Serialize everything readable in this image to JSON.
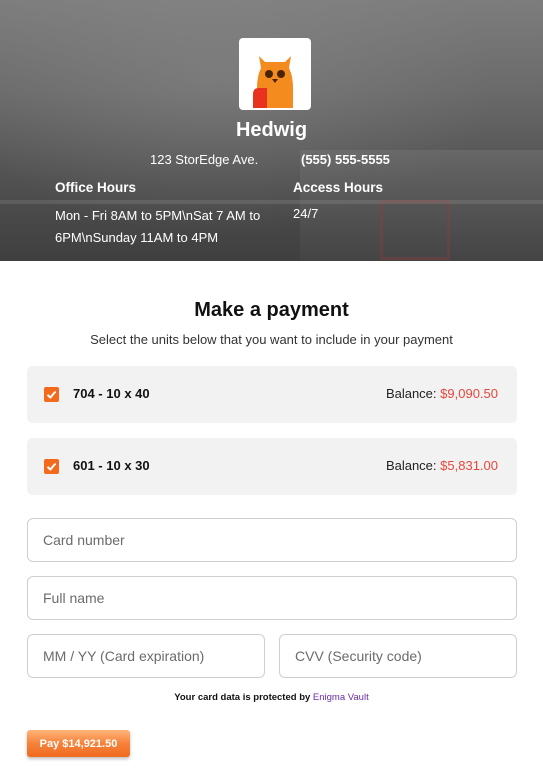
{
  "facility": {
    "name": "Hedwig",
    "address": "123 StorEdge Ave.",
    "phone": "(555) 555-5555",
    "office_hours_label": "Office Hours",
    "office_hours_value": "Mon - Fri 8AM to 5PM\\nSat 7 AM to 6PM\\nSunday 11AM to 4PM",
    "access_hours_label": "Access Hours",
    "access_hours_value": "24/7",
    "logo_icon": "owl-logo-icon"
  },
  "payment": {
    "title": "Make a payment",
    "subtitle": "Select the units below that you want to include in your payment",
    "balance_label": "Balance:",
    "units": [
      {
        "name": "704 - 10 x 40",
        "balance": "$9,090.50",
        "checked": true
      },
      {
        "name": "601 - 10 x 30",
        "balance": "$5,831.00",
        "checked": true
      }
    ]
  },
  "card_form": {
    "card_number_placeholder": "Card number",
    "full_name_placeholder": "Full name",
    "expiration_placeholder": "MM / YY (Card expiration)",
    "cvv_placeholder": "CVV (Security code)"
  },
  "security_note": {
    "text": "Your card data is protected by",
    "provider": "Enigma Vault"
  },
  "pay_button_label": "Pay $14,921.50",
  "colors": {
    "accent": "#f36a1c",
    "balance_amount": "#e8463a",
    "vault_link": "#6a2ca8"
  }
}
